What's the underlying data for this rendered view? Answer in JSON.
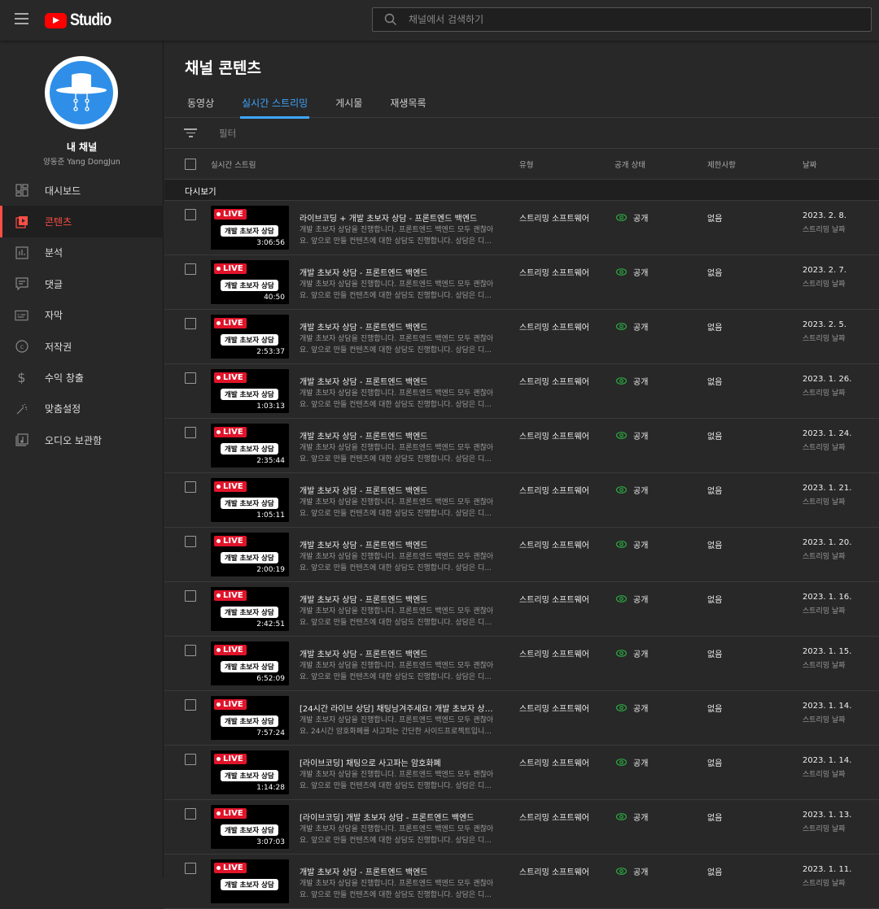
{
  "header": {
    "logo_text": "Studio",
    "search_placeholder": "채널에서 검색하기"
  },
  "channel": {
    "name": "내 채널",
    "owner": "양동준 Yang DongJun"
  },
  "sidebar": {
    "items": [
      {
        "label": "대시보드",
        "icon": "dashboard-icon"
      },
      {
        "label": "콘텐츠",
        "icon": "content-icon",
        "active": true
      },
      {
        "label": "분석",
        "icon": "analytics-icon"
      },
      {
        "label": "댓글",
        "icon": "comments-icon"
      },
      {
        "label": "자막",
        "icon": "subtitles-icon"
      },
      {
        "label": "저작권",
        "icon": "copyright-icon"
      },
      {
        "label": "수익 창출",
        "icon": "dollar-icon"
      },
      {
        "label": "맞춤설정",
        "icon": "magic-wand-icon"
      },
      {
        "label": "오디오 보관함",
        "icon": "audio-library-icon"
      }
    ]
  },
  "main": {
    "title": "채널 콘텐츠",
    "tabs": [
      "동영상",
      "실시간 스트리밍",
      "게시물",
      "재생목록"
    ],
    "filter_label": "필터",
    "columns": {
      "stream": "실시간 스트림",
      "type": "유형",
      "visibility": "공개 상태",
      "restrictions": "제한사항",
      "date": "날짜"
    },
    "section": "다시보기",
    "live_badge": "LIVE",
    "thumb_tag": "개발 초보자 상담",
    "accent": "#3ea6ff",
    "live_color": "#e0142a",
    "public_color": "#2ba640",
    "rows": [
      {
        "title": "라이브코딩 + 개발 초보자 상담 - 프론트엔드 백엔드",
        "desc": "개발 초보자 상담을 진행합니다. 프론트엔드 백엔드 모두 괜찮아요. 앞으로 만들 컨텐츠에 대한 상담도 진행합니다. 상담은 디...",
        "duration": "3:06:56",
        "type": "스트리밍 소프트웨어",
        "visibility": "공개",
        "restrictions": "없음",
        "date": "2023. 2. 8.",
        "date_sub": "스트리밍 날짜"
      },
      {
        "title": "개발 초보자 상담 - 프론트엔드 백엔드",
        "desc": "개발 초보자 상담을 진행합니다. 프론트엔드 백엔드 모두 괜찮아요. 앞으로 만들 컨텐츠에 대한 상담도 진행합니다. 상담은 디...",
        "duration": "40:50",
        "type": "스트리밍 소프트웨어",
        "visibility": "공개",
        "restrictions": "없음",
        "date": "2023. 2. 7.",
        "date_sub": "스트리밍 날짜"
      },
      {
        "title": "개발 초보자 상담 - 프론트엔드 백엔드",
        "desc": "개발 초보자 상담을 진행합니다. 프론트엔드 백엔드 모두 괜찮아요. 앞으로 만들 컨텐츠에 대한 상담도 진행합니다. 상담은 디...",
        "duration": "2:53:37",
        "type": "스트리밍 소프트웨어",
        "visibility": "공개",
        "restrictions": "없음",
        "date": "2023. 2. 5.",
        "date_sub": "스트리밍 날짜"
      },
      {
        "title": "개발 초보자 상담 - 프론트엔드 백엔드",
        "desc": "개발 초보자 상담을 진행합니다. 프론트엔드 백엔드 모두 괜찮아요. 앞으로 만들 컨텐츠에 대한 상담도 진행합니다. 상담은 디...",
        "duration": "1:03:13",
        "type": "스트리밍 소프트웨어",
        "visibility": "공개",
        "restrictions": "없음",
        "date": "2023. 1. 26.",
        "date_sub": "스트리밍 날짜"
      },
      {
        "title": "개발 초보자 상담 - 프론트엔드 백엔드",
        "desc": "개발 초보자 상담을 진행합니다. 프론트엔드 백엔드 모두 괜찮아요. 앞으로 만들 컨텐츠에 대한 상담도 진행합니다. 상담은 디...",
        "duration": "2:35:44",
        "type": "스트리밍 소프트웨어",
        "visibility": "공개",
        "restrictions": "없음",
        "date": "2023. 1. 24.",
        "date_sub": "스트리밍 날짜"
      },
      {
        "title": "개발 초보자 상담 - 프론트엔드 백엔드",
        "desc": "개발 초보자 상담을 진행합니다. 프론트엔드 백엔드 모두 괜찮아요. 앞으로 만들 컨텐츠에 대한 상담도 진행합니다. 상담은 디...",
        "duration": "1:05:11",
        "type": "스트리밍 소프트웨어",
        "visibility": "공개",
        "restrictions": "없음",
        "date": "2023. 1. 21.",
        "date_sub": "스트리밍 날짜"
      },
      {
        "title": "개발 초보자 상담 - 프론트엔드 백엔드",
        "desc": "개발 초보자 상담을 진행합니다. 프론트엔드 백엔드 모두 괜찮아요. 앞으로 만들 컨텐츠에 대한 상담도 진행합니다. 상담은 디...",
        "duration": "2:00:19",
        "type": "스트리밍 소프트웨어",
        "visibility": "공개",
        "restrictions": "없음",
        "date": "2023. 1. 20.",
        "date_sub": "스트리밍 날짜"
      },
      {
        "title": "개발 초보자 상담 - 프론트엔드 백엔드",
        "desc": "개발 초보자 상담을 진행합니다. 프론트엔드 백엔드 모두 괜찮아요. 앞으로 만들 컨텐츠에 대한 상담도 진행합니다. 상담은 디...",
        "duration": "2:42:51",
        "type": "스트리밍 소프트웨어",
        "visibility": "공개",
        "restrictions": "없음",
        "date": "2023. 1. 16.",
        "date_sub": "스트리밍 날짜"
      },
      {
        "title": "개발 초보자 상담 - 프론트엔드 백엔드",
        "desc": "개발 초보자 상담을 진행합니다. 프론트엔드 백엔드 모두 괜찮아요. 앞으로 만들 컨텐츠에 대한 상담도 진행합니다. 상담은 디...",
        "duration": "6:52:09",
        "type": "스트리밍 소프트웨어",
        "visibility": "공개",
        "restrictions": "없음",
        "date": "2023. 1. 15.",
        "date_sub": "스트리밍 날짜"
      },
      {
        "title": "[24시간 라이브 상담] 채팅남겨주세요! 개발 초보자 상담 -...",
        "desc": "개발 초보자 상담을 진행합니다. 프론트엔드 백엔드 모두 괜찮아요. 24시간 암호화폐를 사고파는 간단한 사이드프로젝트입니...",
        "duration": "7:57:24",
        "type": "스트리밍 소프트웨어",
        "visibility": "공개",
        "restrictions": "없음",
        "date": "2023. 1. 14.",
        "date_sub": "스트리밍 날짜"
      },
      {
        "title": "[라이브코딩] 채팅으로 사고파는 암호화폐",
        "desc": "개발 초보자 상담을 진행합니다. 프론트엔드 백엔드 모두 괜찮아요. 앞으로 만들 컨텐츠에 대한 상담도 진행합니다. 상담은 디...",
        "duration": "1:14:28",
        "type": "스트리밍 소프트웨어",
        "visibility": "공개",
        "restrictions": "없음",
        "date": "2023. 1. 14.",
        "date_sub": "스트리밍 날짜"
      },
      {
        "title": "[라이브코딩] 개발 초보자 상담 - 프론트엔드 백엔드",
        "desc": "개발 초보자 상담을 진행합니다. 프론트엔드 백엔드 모두 괜찮아요. 앞으로 만들 컨텐츠에 대한 상담도 진행합니다. 상담은 디...",
        "duration": "3:07:03",
        "type": "스트리밍 소프트웨어",
        "visibility": "공개",
        "restrictions": "없음",
        "date": "2023. 1. 13.",
        "date_sub": "스트리밍 날짜"
      },
      {
        "title": "개발 초보자 상담 - 프론트엔드 백엔드",
        "desc": "개발 초보자 상담을 진행합니다. 프론트엔드 백엔드 모두 괜찮아요. 앞으로 만들 컨텐츠에 대한 상담도 진행합니다. 상담은 디...",
        "duration": "",
        "type": "스트리밍 소프트웨어",
        "visibility": "공개",
        "restrictions": "없음",
        "date": "2023. 1. 11.",
        "date_sub": "스트리밍 날짜"
      }
    ]
  }
}
